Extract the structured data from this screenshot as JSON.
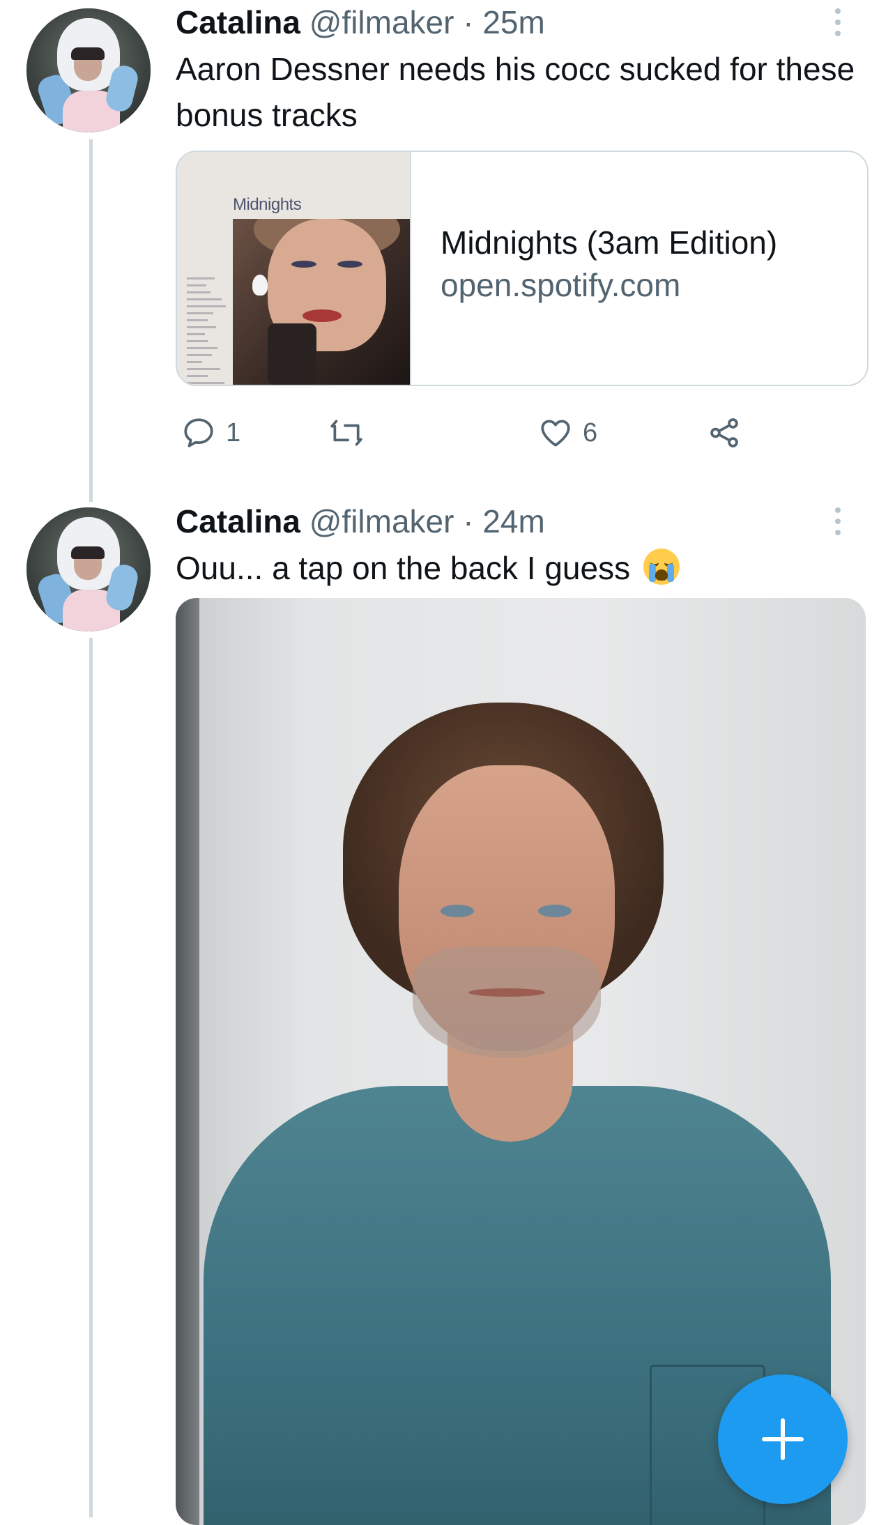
{
  "tweets": [
    {
      "display_name": "Catalina",
      "meta": "@filmaker · 25m",
      "text": "Aaron Dessner needs his cocc sucked for these bonus tracks",
      "link_card": {
        "album_cover_title": "Midnights",
        "title": "Midnights (3am Edition)",
        "domain": "open.spotify.com"
      },
      "actions": {
        "reply_count": "1",
        "retweet_count": "",
        "like_count": "6"
      }
    },
    {
      "display_name": "Catalina",
      "meta": "@filmaker · 24m",
      "text": "Ouu... a tap on the back I guess",
      "emoji": "loudly-crying-face"
    }
  ],
  "icons": {
    "reply": "reply-icon",
    "retweet": "retweet-icon",
    "like": "heart-icon",
    "share": "share-icon",
    "more": "more-vertical-icon",
    "compose": "plus-icon"
  },
  "colors": {
    "accent": "#1d9bf0",
    "text_primary": "#0f1419",
    "text_secondary": "#536471",
    "border": "#cfd9de"
  }
}
